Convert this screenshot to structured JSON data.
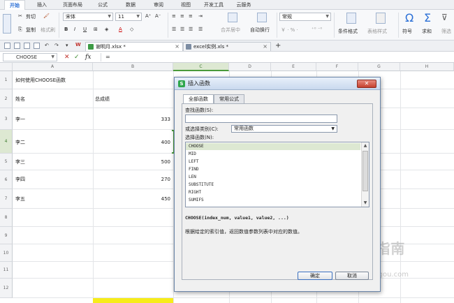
{
  "menubar": {
    "tabs": [
      "开始",
      "插入",
      "页面布局",
      "公式",
      "数据",
      "审阅",
      "视图",
      "开发工具",
      "云服务"
    ],
    "active": "开始"
  },
  "ribbon": {
    "cut": "剪切",
    "paste_icon": "paste-icon",
    "copy": "复制",
    "format_painter": "格式刷",
    "font_name": "宋体",
    "font_size": "11",
    "bold": "B",
    "italic": "I",
    "underline": "U",
    "merge_center": "合并居中",
    "wrap_text": "自动换行",
    "number_format": "常规",
    "conditional_format": "条件格式",
    "table_style": "表格样式",
    "symbol": "符号",
    "sum": "求和",
    "filter": "筛选"
  },
  "docbar": {
    "tabs": [
      {
        "label": "谢明月.xlsx *",
        "close": "×"
      },
      {
        "label": "excel实例.xls *",
        "close": "×"
      }
    ],
    "new_tab": "+"
  },
  "formula_bar": {
    "name_box": "CHOOSE",
    "cancel": "✕",
    "confirm": "✓",
    "fx": "fx",
    "content": "="
  },
  "sheet": {
    "columns": [
      "A",
      "B",
      "C",
      "D",
      "E",
      "F",
      "G",
      "H"
    ],
    "selected_column": "C",
    "rows": [
      "1",
      "2",
      "3",
      "4",
      "5",
      "6",
      "7",
      "8",
      "9",
      "10",
      "11",
      "12"
    ],
    "selected_row": "4",
    "cells": {
      "a1": "如何使用CHOOSE函数",
      "a2": "姓名",
      "b2": "总成绩",
      "a3": "李一",
      "b3": "333",
      "a4": "李二",
      "b4": "400",
      "a5": "李三",
      "b5": "500",
      "a6": "李四",
      "b6": "270",
      "a7": "李五",
      "b7": "450"
    }
  },
  "dialog": {
    "title": "插入函数",
    "close": "✕",
    "tabs": [
      "全部函数",
      "常用公式"
    ],
    "search_label": "查找函数(S):",
    "search_value": "",
    "category_label": "或选择类别(C):",
    "category_value": "常用函数",
    "select_label": "选择函数(N):",
    "functions": [
      "CHOOSE",
      "MID",
      "LEFT",
      "FIND",
      "LEN",
      "SUBSTITUTE",
      "RIGHT",
      "SUMIFS"
    ],
    "selected_function": "CHOOSE",
    "signature": "CHOOSE(index_num, value1, value2, ...)",
    "description": "根据给定的索引值，返回数值参数列表中对应的数值。",
    "ok": "确定",
    "cancel": "取消"
  },
  "watermark": {
    "text": "搜狗指南",
    "url": "zhinan.sogou.com"
  },
  "colors": {
    "accent": "#2a6fd6",
    "selection_green": "#4a9a3a",
    "highlight": "#f7ec1a"
  }
}
